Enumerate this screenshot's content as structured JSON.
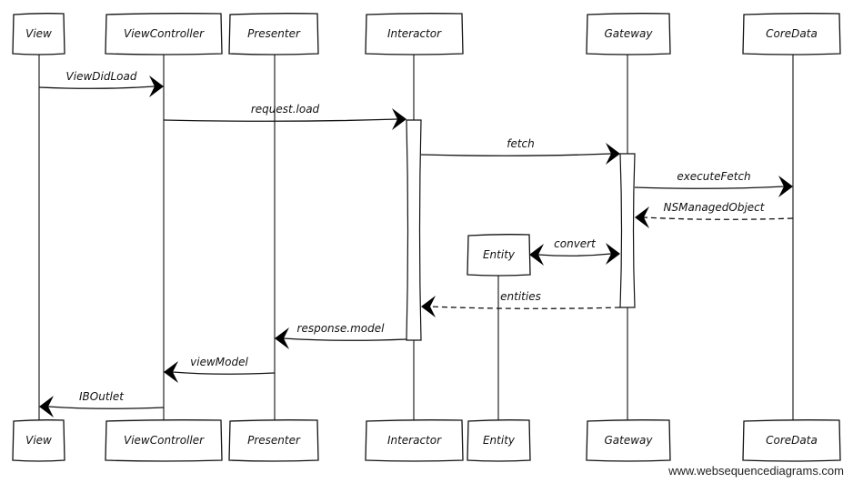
{
  "participants": [
    {
      "id": "view",
      "label": "View"
    },
    {
      "id": "viewcontroller",
      "label": "ViewController"
    },
    {
      "id": "presenter",
      "label": "Presenter"
    },
    {
      "id": "interactor",
      "label": "Interactor"
    },
    {
      "id": "entity",
      "label": "Entity",
      "created_by": "convert"
    },
    {
      "id": "gateway",
      "label": "Gateway"
    },
    {
      "id": "coredata",
      "label": "CoreData"
    }
  ],
  "messages": [
    {
      "from": "view",
      "to": "viewcontroller",
      "label": "ViewDidLoad",
      "style": "solid"
    },
    {
      "from": "viewcontroller",
      "to": "interactor",
      "label": "request.load",
      "style": "solid"
    },
    {
      "from": "interactor",
      "to": "gateway",
      "label": "fetch",
      "style": "solid"
    },
    {
      "from": "gateway",
      "to": "coredata",
      "label": "executeFetch",
      "style": "solid"
    },
    {
      "from": "coredata",
      "to": "gateway",
      "label": "NSManagedObject",
      "style": "dashed"
    },
    {
      "from": "entity",
      "to": "gateway",
      "label": "convert",
      "style": "bidirectional"
    },
    {
      "from": "gateway",
      "to": "interactor",
      "label": "entities",
      "style": "dashed"
    },
    {
      "from": "interactor",
      "to": "presenter",
      "label": "response.model",
      "style": "solid"
    },
    {
      "from": "presenter",
      "to": "viewcontroller",
      "label": "viewModel",
      "style": "solid"
    },
    {
      "from": "viewcontroller",
      "to": "view",
      "label": "IBOutlet",
      "style": "solid"
    }
  ],
  "activations": [
    {
      "participant": "interactor",
      "from_message": 1,
      "to_message": 7
    },
    {
      "participant": "gateway",
      "from_message": 2,
      "to_message": 6
    }
  ],
  "watermark": "www.websequencediagrams.com"
}
